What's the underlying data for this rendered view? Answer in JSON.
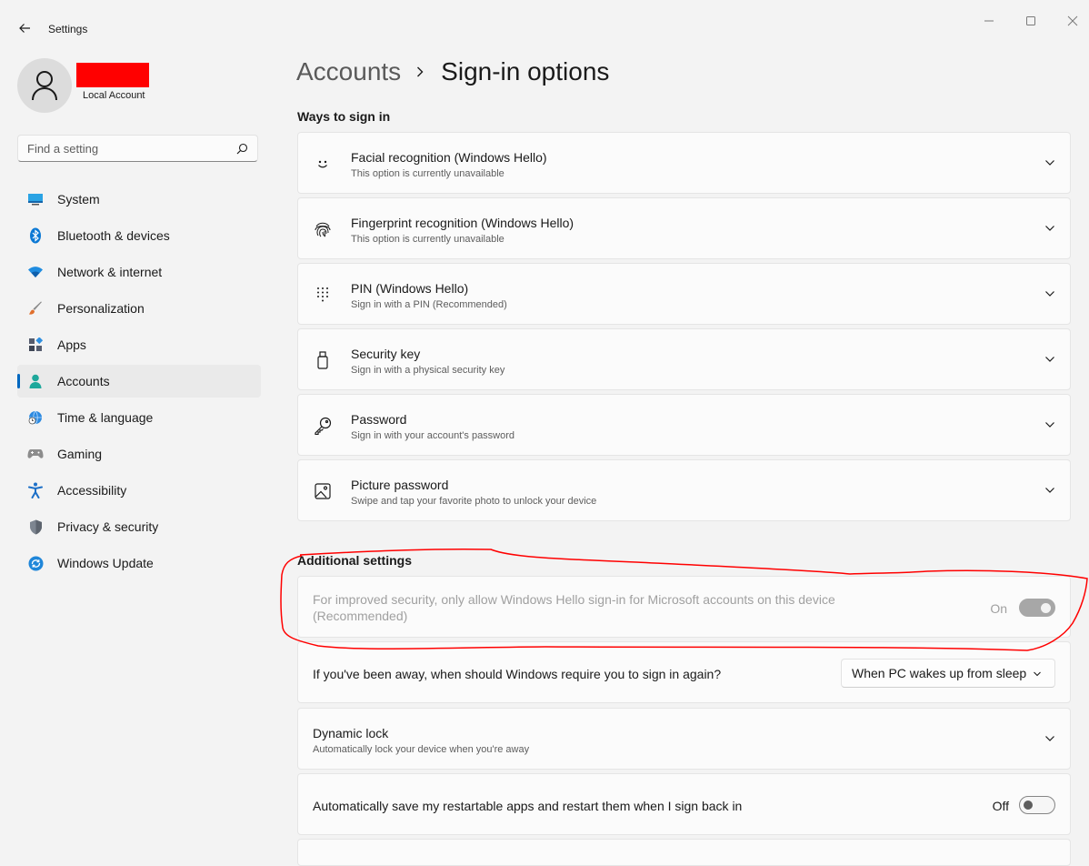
{
  "app": {
    "title": "Settings"
  },
  "user": {
    "account_type": "Local Account"
  },
  "search": {
    "placeholder": "Find a setting"
  },
  "sidebar": {
    "items": [
      {
        "label": "System",
        "icon": "monitor-icon"
      },
      {
        "label": "Bluetooth & devices",
        "icon": "bluetooth-icon"
      },
      {
        "label": "Network & internet",
        "icon": "wifi-icon"
      },
      {
        "label": "Personalization",
        "icon": "brush-icon"
      },
      {
        "label": "Apps",
        "icon": "apps-icon"
      },
      {
        "label": "Accounts",
        "icon": "person-icon",
        "active": true
      },
      {
        "label": "Time & language",
        "icon": "globe-clock-icon"
      },
      {
        "label": "Gaming",
        "icon": "gamepad-icon"
      },
      {
        "label": "Accessibility",
        "icon": "accessibility-icon"
      },
      {
        "label": "Privacy & security",
        "icon": "shield-icon"
      },
      {
        "label": "Windows Update",
        "icon": "update-icon"
      }
    ]
  },
  "breadcrumb": {
    "parent": "Accounts",
    "current": "Sign-in options"
  },
  "ways": {
    "heading": "Ways to sign in",
    "items": [
      {
        "title": "Facial recognition (Windows Hello)",
        "subtitle": "This option is currently unavailable",
        "icon": "face-icon"
      },
      {
        "title": "Fingerprint recognition (Windows Hello)",
        "subtitle": "This option is currently unavailable",
        "icon": "fingerprint-icon"
      },
      {
        "title": "PIN (Windows Hello)",
        "subtitle": "Sign in with a PIN (Recommended)",
        "icon": "keypad-icon"
      },
      {
        "title": "Security key",
        "subtitle": "Sign in with a physical security key",
        "icon": "usb-key-icon"
      },
      {
        "title": "Password",
        "subtitle": "Sign in with your account's password",
        "icon": "key-icon"
      },
      {
        "title": "Picture password",
        "subtitle": "Swipe and tap your favorite photo to unlock your device",
        "icon": "picture-icon"
      }
    ]
  },
  "additional": {
    "heading": "Additional settings",
    "hello_only": {
      "text": "For improved security, only allow Windows Hello sign-in for Microsoft accounts on this device (Recommended)",
      "state": "On",
      "enabled": false
    },
    "require_signin": {
      "text": "If you've been away, when should Windows require you to sign in again?",
      "value": "When PC wakes up from sleep"
    },
    "dynamic_lock": {
      "title": "Dynamic lock",
      "subtitle": "Automatically lock your device when you're away"
    },
    "restart_apps": {
      "text": "Automatically save my restartable apps and restart them when I sign back in",
      "state": "Off"
    }
  },
  "colors": {
    "accent": "#0067c0",
    "annotation": "#ff0000",
    "redaction": "#ff0000"
  }
}
